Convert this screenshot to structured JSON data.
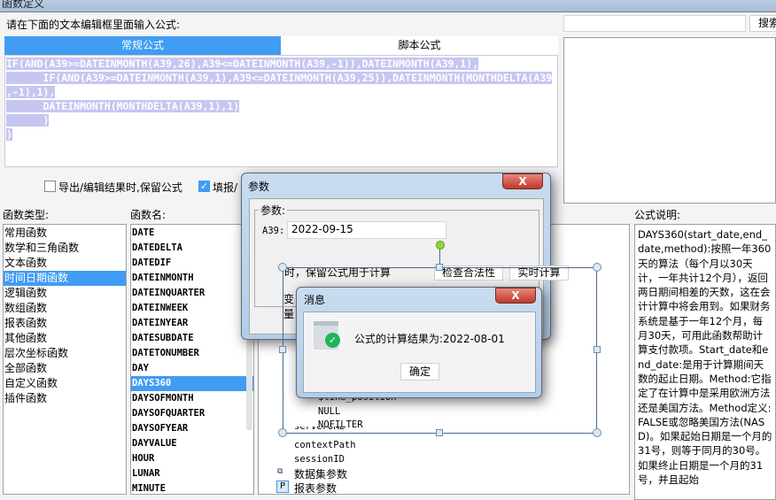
{
  "window": {
    "title": "函数定义"
  },
  "prompt": "请在下面的文本编辑框里面输入公式:",
  "tabs": [
    {
      "label": "常规公式",
      "active": true
    },
    {
      "label": "脚本公式",
      "active": false
    }
  ],
  "formula_lines": [
    "IF(AND(A39>=DATEINMONTH(A39,26),A39<=DATEINMONTH(A39,-1)),DATEINMONTH(A39,1),",
    "      IF(AND(A39>=DATEINMONTH(A39,1),A39<=DATEINMONTH(A39,25)),DATEINMONTH(MONTHDELTA(A39",
    ",-1),1),",
    "      DATEINMONTH(MONTHDELTA(A39,1),1)",
    "      )",
    ")"
  ],
  "search": {
    "value": "",
    "button": "搜索"
  },
  "options": {
    "keep_formula": {
      "label": "导出/编辑结果时,保留公式",
      "checked": false
    },
    "fill": {
      "label": "填报/",
      "checked": true
    }
  },
  "labels": {
    "types": "函数类型:",
    "names": "函数名:",
    "desc": "公式说明:"
  },
  "function_types": [
    "常用函数",
    "数学和三角函数",
    "文本函数",
    "时间日期函数",
    "逻辑函数",
    "数组函数",
    "报表函数",
    "其他函数",
    "层次坐标函数",
    "全部函数",
    "自定义函数",
    "插件函数"
  ],
  "selected_type": "时间日期函数",
  "function_names": [
    "DATE",
    "DATEDELTA",
    "DATEDIF",
    "DATEINMONTH",
    "DATEINQUARTER",
    "DATEINWEEK",
    "DATEINYEAR",
    "DATESUBDATE",
    "DATETONUMBER",
    "DAY",
    "DAYS360",
    "DAYSOFMONTH",
    "DAYSOFQUARTER",
    "DAYSOFYEAR",
    "DAYVALUE",
    "HOUR",
    "LUNAR",
    "MINUTE"
  ],
  "selected_name": "DAYS360",
  "description": "DAYS360(start_date,end_date,method):按照一年360天的算法（每个月以30天计，一年共计12个月），返回两日期间相差的天数，这在会计计算中将会用到。如果财务系统是基于一年12个月，每月30天，可用此函数帮助计算支付款项。Start_date和end_date:是用于计算期间天数的起止日期。Method:它指定了在计算中是采用欧洲方法还是美国方法。Method定义:FALSE或忽略美国方法(NASD)。如果起始日期是一个月的31号，则等于同月的30号。如果终止日期是一个月的31号，并且起始",
  "behind": {
    "keep_text": "时，保留公式用于计算",
    "check_btn": "检查合法性",
    "realtime_btn": "实时计算",
    "var_text": "变量"
  },
  "tree": {
    "items": [
      "$line_position",
      "NULL",
      "NOFILTER",
      "serverURL",
      "contextPath",
      "sessionID"
    ],
    "dataset_params": "数据集参数",
    "report_params": "报表参数"
  },
  "param_dialog": {
    "title": "参数",
    "group": "参数:",
    "param_label": "A39:",
    "param_value": "2022-09-15",
    "close": "X"
  },
  "message_dialog": {
    "title": "消息",
    "message": "公式的计算结果为:2022-08-01",
    "ok": "确定",
    "close": "X"
  },
  "colors": {
    "accent": "#419cf3",
    "selection": "#c6c6f2"
  }
}
